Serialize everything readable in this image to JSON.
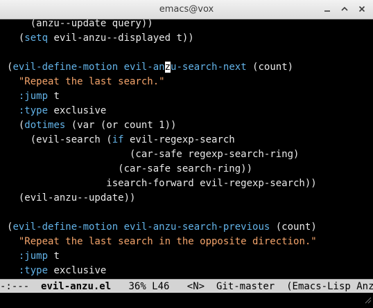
{
  "window": {
    "title": "emacs@vox"
  },
  "editor": {
    "lines": [
      [
        "    (anzu--update query))"
      ],
      [
        "  (setq evil-anzu--displayed t))"
      ],
      [
        ""
      ],
      [
        "(evil-define-motion evil-anzu-search-next (count)"
      ],
      [
        "  \"Repeat the last search.\""
      ],
      [
        "  :jump t"
      ],
      [
        "  :type exclusive"
      ],
      [
        "  (dotimes (var (or count 1))"
      ],
      [
        "    (evil-search (if evil-regexp-search"
      ],
      [
        "                     (car-safe regexp-search-ring)"
      ],
      [
        "                   (car-safe search-ring))"
      ],
      [
        "                 isearch-forward evil-regexp-search))"
      ],
      [
        "  (evil-anzu--update))"
      ],
      [
        ""
      ],
      [
        "(evil-define-motion evil-anzu-search-previous (count)"
      ],
      [
        "  \"Repeat the last search in the opposite direction.\""
      ],
      [
        "  :jump t"
      ],
      [
        "  :type exclusive"
      ]
    ]
  },
  "modeline": {
    "status": "-:---",
    "buffer": "evil-anzu.el",
    "position": "36% L46",
    "state": "<N>",
    "vc": "Git-master",
    "modes": "(Emacs-Lisp Anzu"
  },
  "colors": {
    "keyword": "#63b3e8",
    "string": "#f4a46b",
    "foreground": "#eaeaea",
    "modeline_bg": "#d4d4d4"
  },
  "icons": {
    "minimize": "minimize-icon",
    "maximize": "maximize-icon",
    "close": "close-icon",
    "resize": "resize-grip-icon"
  }
}
